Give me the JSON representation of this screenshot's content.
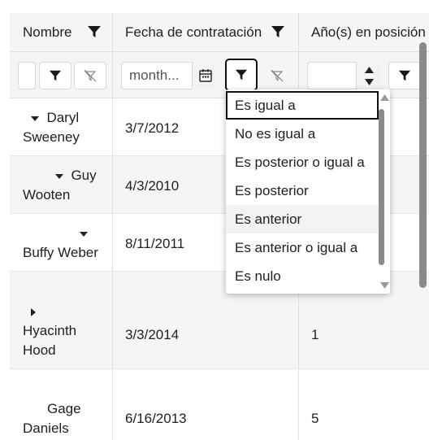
{
  "columns": [
    {
      "label": "Nombre"
    },
    {
      "label": "Fecha de contratación"
    },
    {
      "label": "Año(s) en posición"
    }
  ],
  "filter_row": {
    "date_placeholder": "month...",
    "number_value": ""
  },
  "rows": [
    {
      "name": "Daryl Sweeney",
      "expander": "expanded",
      "date": "3/7/2012",
      "years": ""
    },
    {
      "name": "Guy Wooten",
      "expander": "expanded",
      "date": "4/3/2010",
      "years": ""
    },
    {
      "name": "Buffy Weber",
      "expander": "expanded",
      "date": "8/11/2011",
      "years": ""
    },
    {
      "name": "Hyacinth Hood",
      "expander": "collapsed",
      "date": "3/3/2014",
      "years": "1"
    },
    {
      "name": "Gage Daniels",
      "expander": "none",
      "date": "6/16/2013",
      "years": "5"
    }
  ],
  "row_lines": {
    "r0": [
      "Daryl",
      "Sweeney"
    ],
    "r1": [
      "Guy",
      "Wooten"
    ],
    "r2": [
      "",
      "Buffy Weber"
    ],
    "r3": [
      "",
      "Hyacinth",
      "Hood"
    ],
    "r4": [
      "Gage",
      "Daniels"
    ]
  },
  "condition_menu": {
    "items": [
      "Es igual a",
      "No es igual a",
      "Es posterior o igual a",
      "Es posterior",
      "Es anterior",
      "Es anterior o igual a",
      "Es nulo"
    ],
    "focused_index": 0,
    "hover_index": 4
  },
  "icons": {
    "filter": "filter-icon",
    "clear_filter": "clear-filter-icon",
    "calendar": "calendar-icon",
    "spin_up": "spin-up-icon",
    "spin_down": "spin-down-icon"
  },
  "colors": {
    "header_bg": "#f5f5f5",
    "alt_row_bg": "#f5f5f5",
    "border": "#e0e0e0",
    "focus_border": "#111111",
    "scrollbar": "#8a8a8a"
  }
}
